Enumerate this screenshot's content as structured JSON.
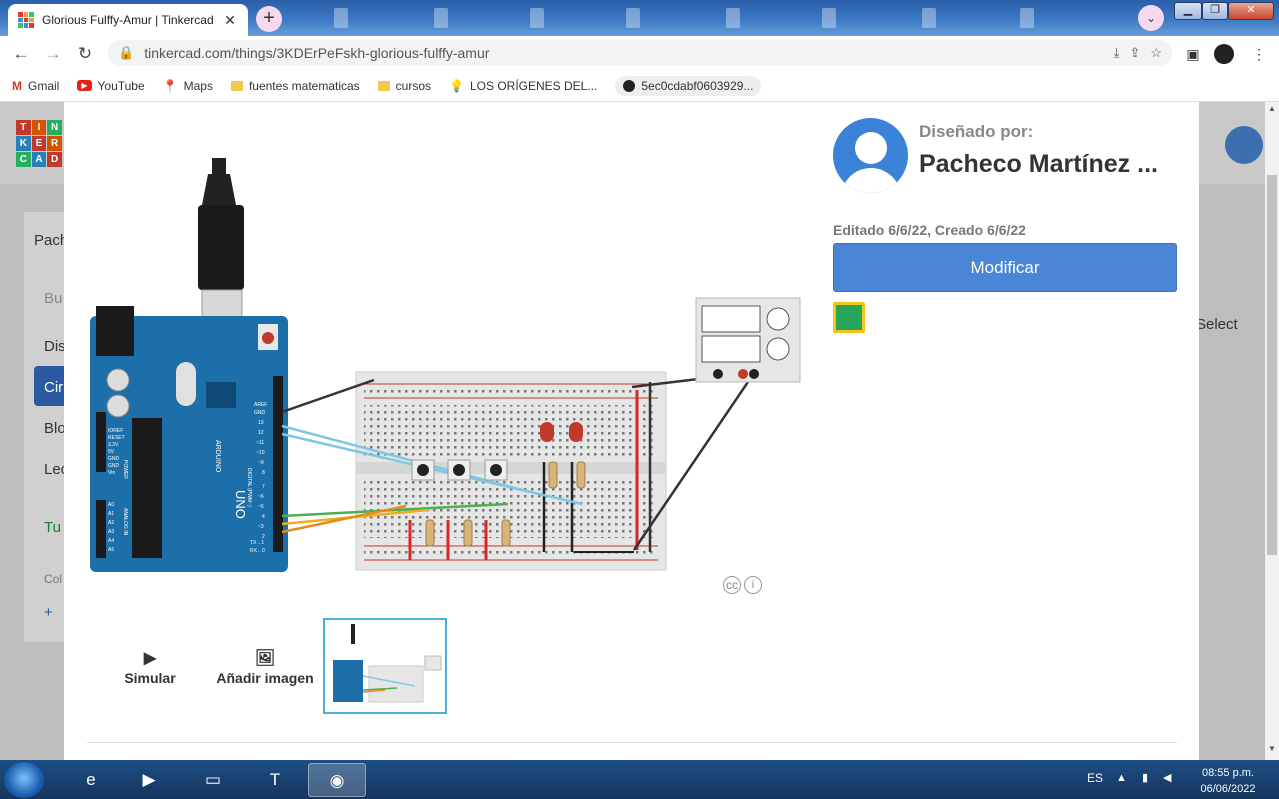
{
  "browser": {
    "tab_title": "Glorious Fulffy-Amur | Tinkercad",
    "url": "tinkercad.com/things/3KDErPeFskh-glorious-fulffy-amur",
    "new_tab_label": "+"
  },
  "bookmarks": [
    {
      "label": "Gmail",
      "icon": "gmail-icon"
    },
    {
      "label": "YouTube",
      "icon": "youtube-icon"
    },
    {
      "label": "Maps",
      "icon": "maps-icon"
    },
    {
      "label": "fuentes matematicas",
      "icon": "folder-icon"
    },
    {
      "label": "cursos",
      "icon": "folder-icon"
    },
    {
      "label": "LOS ORÍGENES DEL...",
      "icon": "bulb-icon"
    },
    {
      "label": "5ec0cdabf0603929...",
      "icon": "github-icon"
    }
  ],
  "background_page": {
    "logo_letters": [
      "T",
      "I",
      "N",
      "K",
      "E",
      "R",
      "C",
      "A",
      "D"
    ],
    "sidebar_items": [
      "Pach",
      "Bu",
      "Dis",
      "Cir",
      "Blo",
      "Lec",
      "Tu",
      "Col",
      "+"
    ],
    "select_label": "Select"
  },
  "modal": {
    "designed_by_label": "Diseñado por:",
    "author_name": "Pacheco Martínez ...",
    "edited_text": "Editado 6/6/22, Creado 6/6/22",
    "modify_button": "Modificar",
    "cc_label": "cc",
    "actions": {
      "simulate": "Simular",
      "add_image": "Añadir imagen"
    }
  },
  "circuit": {
    "board_name": "UNO",
    "board_brand": "ARDUINO",
    "board_labels": [
      "AREF",
      "GND",
      "13",
      "12",
      "~11",
      "~10",
      "~9",
      "8",
      "7",
      "~6",
      "~5",
      "4",
      "~3",
      "2",
      "TX→1",
      "RX←0"
    ],
    "side_labels": [
      "DIGITAL (PWM~)",
      "POWER",
      "ANALOG IN"
    ],
    "power_labels": [
      "IOREF",
      "RESET",
      "3.3V",
      "5V",
      "GND",
      "GND",
      "Vin"
    ],
    "analog_labels": [
      "A0",
      "A1",
      "A2",
      "A3",
      "A4",
      "A5"
    ]
  },
  "taskbar": {
    "language": "ES",
    "time": "08:55 p.m.",
    "date": "06/06/2022"
  },
  "colors": {
    "accent": "#4a85d8",
    "arduino_blue": "#1c6fa8",
    "wire_cyan": "#7ec8e3",
    "wire_green": "#4caf50",
    "wire_orange": "#e8891c",
    "led_red": "#c0392b"
  }
}
